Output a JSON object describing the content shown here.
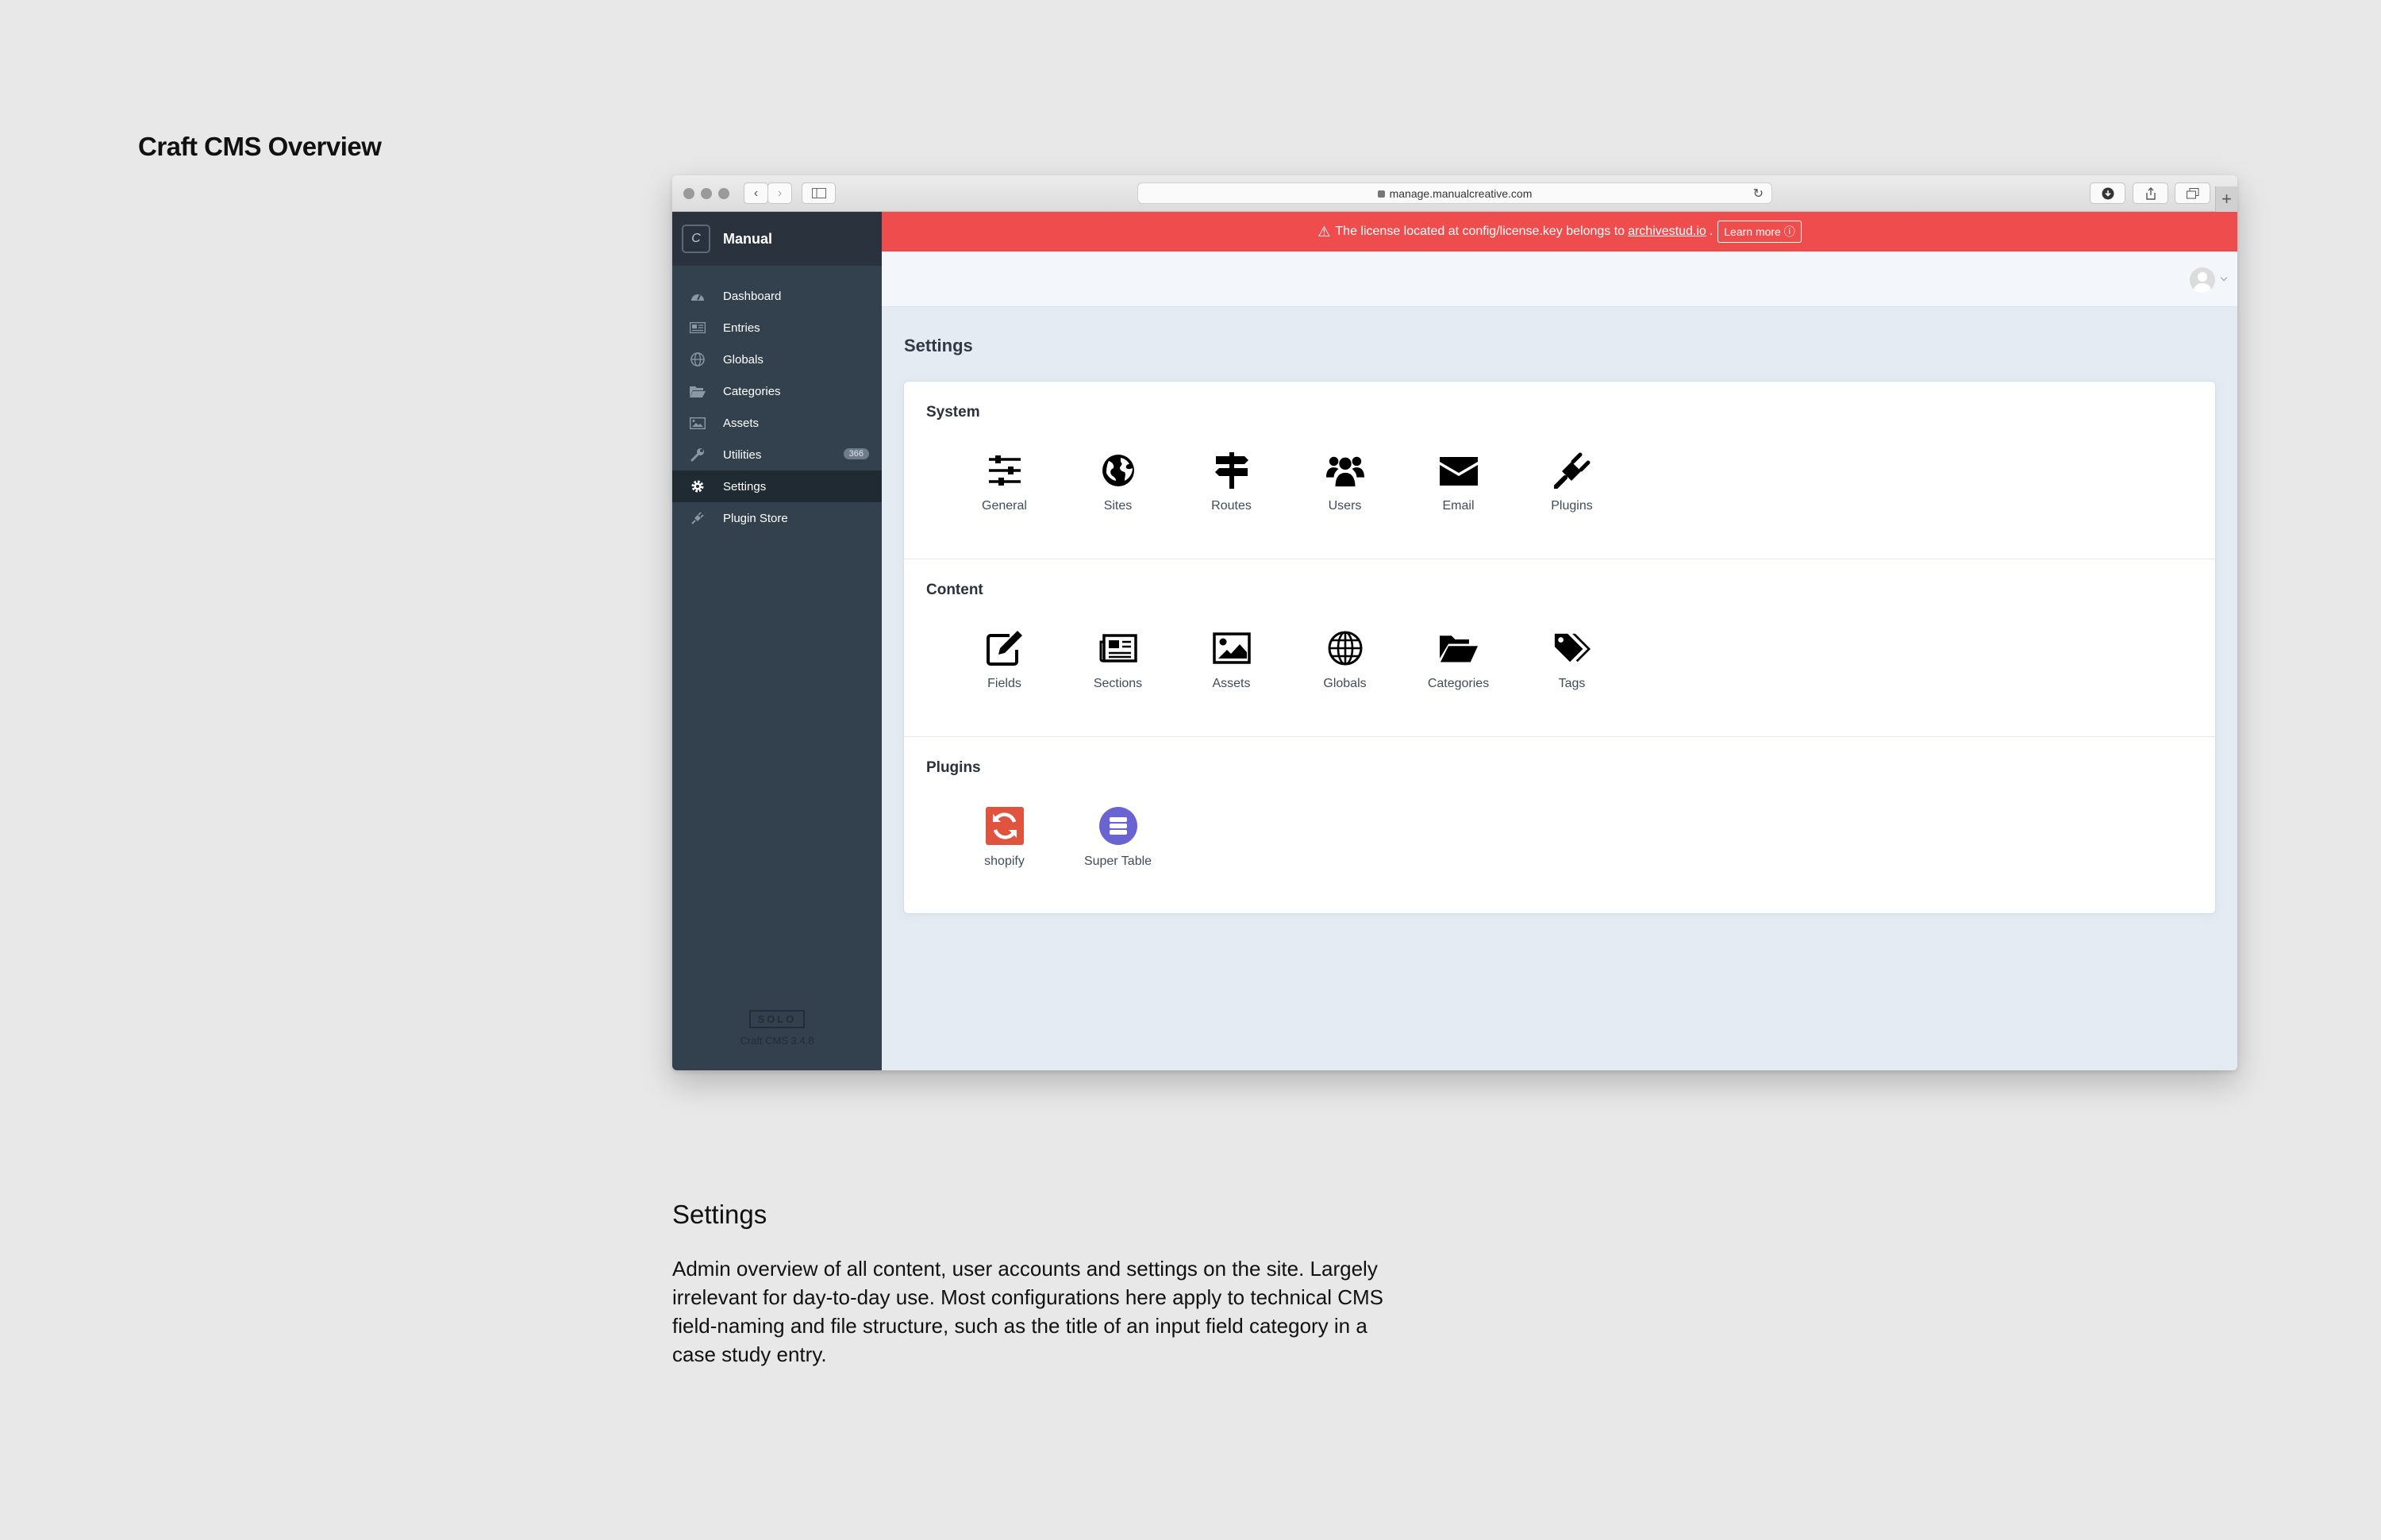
{
  "page": {
    "heading": "Craft CMS Overview"
  },
  "browser": {
    "url": "manage.manualcreative.com"
  },
  "cms": {
    "site_name": "Manual",
    "logo_letter": "C",
    "nav": [
      {
        "label": "Dashboard",
        "icon": "gauge-icon"
      },
      {
        "label": "Entries",
        "icon": "newspaper-icon"
      },
      {
        "label": "Globals",
        "icon": "globe-icon"
      },
      {
        "label": "Categories",
        "icon": "folder-icon"
      },
      {
        "label": "Assets",
        "icon": "image-icon"
      },
      {
        "label": "Utilities",
        "icon": "wrench-icon",
        "badge": "366"
      },
      {
        "label": "Settings",
        "icon": "gear-icon",
        "active": true
      },
      {
        "label": "Plugin Store",
        "icon": "plug-icon"
      }
    ],
    "footer": {
      "edition": "SOLO",
      "version": "Craft CMS 3.4.8"
    },
    "alert": {
      "text_before": "The license located at config/license.key belongs to",
      "link": "archivestud.io",
      "text_after": ".",
      "button": "Learn more",
      "button_icon": "ⓘ",
      "color": "#ef4d4d"
    },
    "page_title": "Settings",
    "sections": [
      {
        "title": "System",
        "tiles": [
          {
            "label": "General",
            "icon": "sliders-icon"
          },
          {
            "label": "Sites",
            "icon": "earth-icon"
          },
          {
            "label": "Routes",
            "icon": "signpost-icon"
          },
          {
            "label": "Users",
            "icon": "users-icon"
          },
          {
            "label": "Email",
            "icon": "envelope-icon"
          },
          {
            "label": "Plugins",
            "icon": "plug-icon"
          }
        ]
      },
      {
        "title": "Content",
        "tiles": [
          {
            "label": "Fields",
            "icon": "edit-icon"
          },
          {
            "label": "Sections",
            "icon": "newspaper-icon"
          },
          {
            "label": "Assets",
            "icon": "image-icon"
          },
          {
            "label": "Globals",
            "icon": "globe-icon"
          },
          {
            "label": "Categories",
            "icon": "folder-open-icon"
          },
          {
            "label": "Tags",
            "icon": "tags-icon"
          }
        ]
      },
      {
        "title": "Plugins",
        "tiles": [
          {
            "label": "shopify",
            "icon": "shopify-sync-icon"
          },
          {
            "label": "Super Table",
            "icon": "super-table-icon"
          }
        ]
      }
    ]
  },
  "caption": {
    "title": "Settings",
    "text": "Admin overview of all content, user accounts and settings on the site. Largely irrelevant for day-to-day use. Most configurations here apply to technical CMS field-naming and file structure, such as the title of an input field category in a case study entry."
  }
}
